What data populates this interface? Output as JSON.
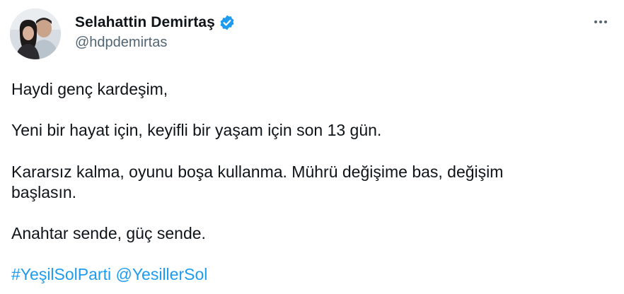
{
  "author": {
    "display_name": "Selahattin Demirtaş",
    "handle": "@hdpdemirtas",
    "verified": true
  },
  "tweet": {
    "line1": "Haydi genç kardeşim,",
    "line2": "Yeni bir hayat için, keyifli bir yaşam için son 13 gün.",
    "line3a": "Kararsız kalma, oyunu boşa kullanma. Mührü değişime bas, değişim",
    "line3b": "başlasın.",
    "line4": "Anahtar sende, güç sende.",
    "hashtag": "#YeşilSolParti",
    "mention": "@YesillerSol"
  },
  "colors": {
    "link": "#1d9bf0",
    "verified_badge": "#1d9bf0",
    "secondary_text": "#536471",
    "primary_text": "#0f1419"
  },
  "icons": {
    "more": "more-dots-icon",
    "verified": "verified-badge-icon"
  }
}
